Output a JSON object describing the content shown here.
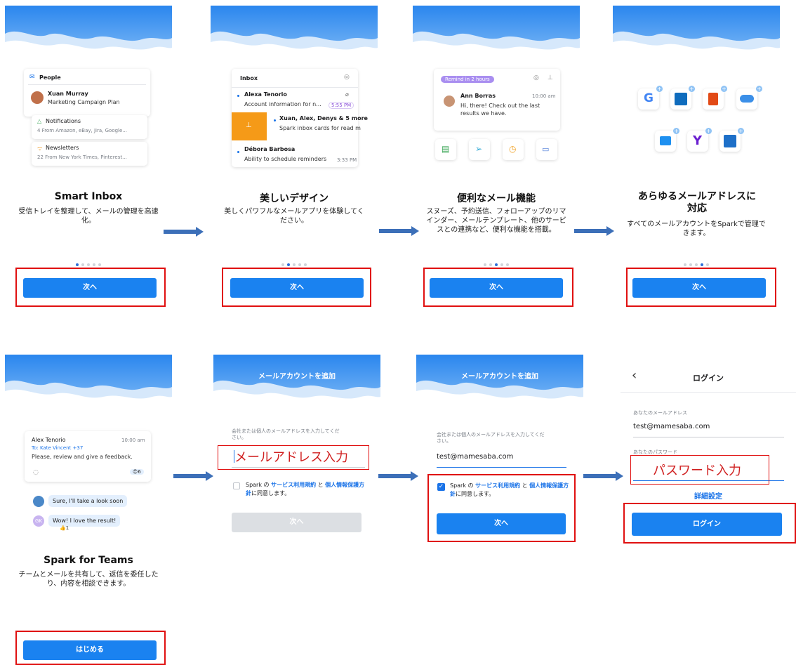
{
  "colors": {
    "accent": "#1a82f0",
    "highlight_box": "#e01010",
    "arrow": "#3c6fb8",
    "sky": "#2e8ef0"
  },
  "s1": {
    "people_header": "People",
    "person_name": "Xuan Murray",
    "person_subject": "Marketing Campaign Plan",
    "notif_title": "Notifications",
    "notif_sub": "4 From Amazon, eBay, Jira, Google...",
    "news_title": "Newsletters",
    "news_sub": "22 From New York Times, Pinterest...",
    "title": "Smart Inbox",
    "desc": "受信トレイを整理して、メールの管理を高速化。",
    "button": "次へ"
  },
  "s2": {
    "inbox_header": "Inbox",
    "m1_name": "Alexa Tenorio",
    "m1_preview": "Account information for n...",
    "m1_time": "5:55 PM",
    "m2_name": "Xuan, Alex, Denys & 5 more",
    "m2_preview": "Spark inbox cards for read m",
    "m3_name": "Débora Barbosa",
    "m3_preview": "Ability to schedule reminders",
    "m3_time": "3:33 PM",
    "title": "美しいデザイン",
    "desc": "美しくパワフルなメールアプリを体験してください。",
    "button": "次へ"
  },
  "s3": {
    "remind_badge": "Remind in 2 hours",
    "sender": "Ann Borras",
    "time": "10:00 am",
    "message": "Hi, there! Check out the last results we have.",
    "title": "便利なメール機能",
    "desc": "スヌーズ、予約送信、フォローアップのリマインダー、メールテンプレート、他のサービスとの連携など、便利な機能を搭載。",
    "button": "次へ"
  },
  "s4": {
    "title": "あらゆるメールアドレスに対応",
    "desc": "すべてのメールアカウントをSparkで管理できます。",
    "button": "次へ"
  },
  "s5": {
    "sender": "Alex Tenorio",
    "time": "10:00 am",
    "to": "To: Kate Vincent +37",
    "message": "Please, review and give a feedback.",
    "reaction_count": "6",
    "reply1": "Sure, I'll take a look soon",
    "reply2": "Wow! I love the result!",
    "reply2_initials": "GK",
    "reply2_reaction": "1",
    "title": "Spark for Teams",
    "desc": "チームとメールを共有して、返信を委任したり、内容を相談できます。",
    "button": "はじめる"
  },
  "s6": {
    "header": "メールアカウントを追加",
    "field_label": "会社または個人のメールアドレスを入力してください。",
    "annotation": "メールアドレス入力",
    "consent_pre": "Spark の",
    "terms": "サービス利用規約",
    "and": "と",
    "privacy": "個人情報保護方針",
    "consent_post": "に同意します。",
    "button": "次へ"
  },
  "s7": {
    "header": "メールアカウントを追加",
    "field_label": "会社または個人のメールアドレスを入力してください。",
    "email_value": "test@mamesaba.com",
    "consent_pre": "Spark の",
    "terms": "サービス利用規約",
    "and": "と",
    "privacy": "個人情報保護方針",
    "consent_post": "に同意します。",
    "button": "次へ"
  },
  "s8": {
    "back": "‹",
    "title": "ログイン",
    "email_label": "あなたのメールアドレス",
    "email_value": "test@mamesaba.com",
    "password_label": "あなたのパスワード",
    "annotation": "パスワード入力",
    "advanced": "詳細設定",
    "button": "ログイン"
  }
}
